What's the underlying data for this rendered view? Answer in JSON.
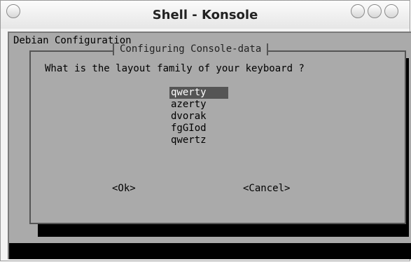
{
  "window": {
    "title": "Shell - Konsole"
  },
  "terminal": {
    "backtitle": "Debian Configuration",
    "dialog": {
      "title": "Configuring Console-data",
      "question": "What is the layout family of your keyboard ?",
      "options": [
        {
          "label": "qwerty",
          "selected": true
        },
        {
          "label": "azerty",
          "selected": false
        },
        {
          "label": "dvorak",
          "selected": false
        },
        {
          "label": "fgGIod",
          "selected": false
        },
        {
          "label": "qwertz",
          "selected": false
        }
      ],
      "ok_label": "<Ok>",
      "cancel_label": "<Cancel>"
    }
  }
}
